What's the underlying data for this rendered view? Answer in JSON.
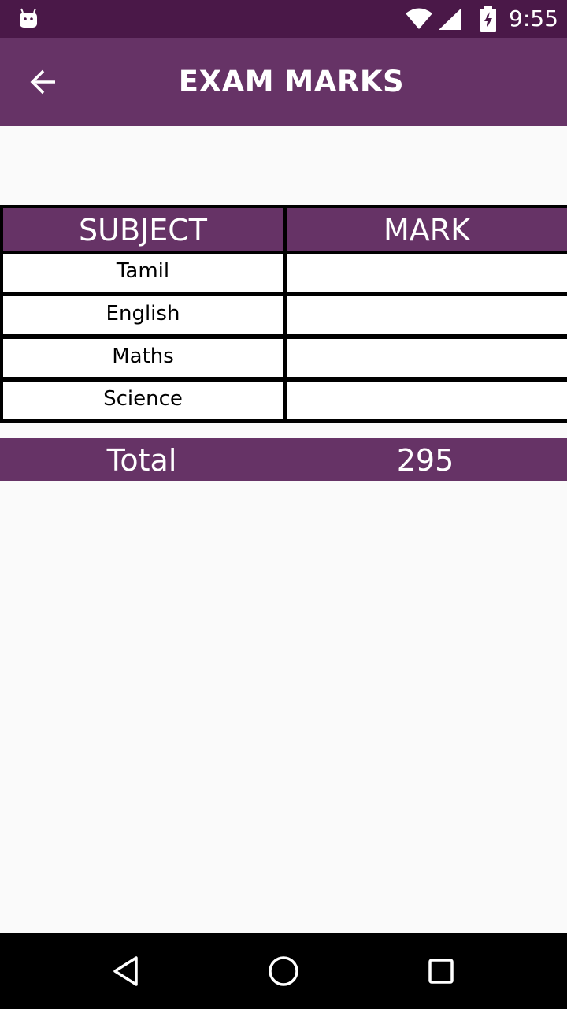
{
  "status_bar": {
    "time": "9:55",
    "icons": [
      "android-icon",
      "wifi-icon",
      "signal-icon",
      "battery-charging-icon"
    ]
  },
  "app_bar": {
    "title": "EXAM MARKS",
    "back_icon": "arrow-back-icon"
  },
  "table": {
    "headers": [
      "SUBJECT",
      "MARK"
    ],
    "rows": [
      {
        "subject": "Tamil",
        "mark": ""
      },
      {
        "subject": "English",
        "mark": ""
      },
      {
        "subject": "Maths",
        "mark": ""
      },
      {
        "subject": "Science",
        "mark": ""
      }
    ]
  },
  "total": {
    "label": "Total",
    "value": "295"
  },
  "nav_bar": {
    "icons": [
      "back-triangle-icon",
      "home-circle-icon",
      "recents-square-icon"
    ]
  },
  "colors": {
    "status_bar": "#4a1848",
    "primary": "#663366",
    "background": "#fafafa"
  }
}
